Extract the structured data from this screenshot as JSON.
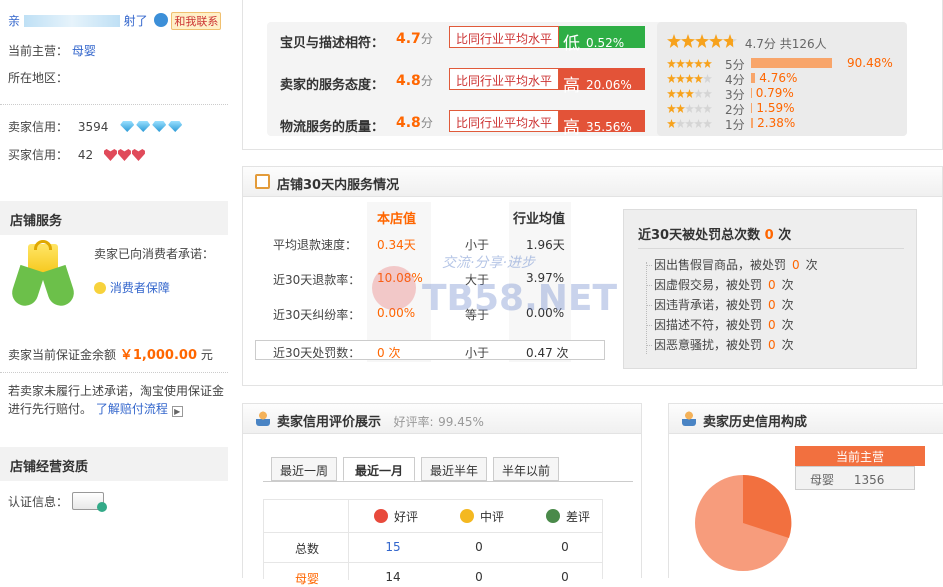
{
  "left": {
    "greet_prefix": "亲",
    "greet_suffix": "射了",
    "contact_label": "和我联系",
    "owner_label": "当前主营：",
    "owner_value": "母婴",
    "region_label": "所在地区：",
    "seller_credit_label": "卖家信用：",
    "seller_credit_value": "3594",
    "buyer_credit_label": "买家信用：",
    "buyer_credit_value": "42",
    "service_heading": "店铺服务",
    "promise_text": "卖家已向消费者承诺：",
    "protection_link": "消费者保障",
    "deposit_label": "卖家当前保证金余额",
    "deposit_value": "￥1,000.00",
    "deposit_unit": "元",
    "note_text": "若卖家未履行上述承诺，淘宝使用保证金进行先行赔付。",
    "claim_link": "了解赔付流程",
    "qual_heading": "店铺经营资质",
    "cert_label": "认证信息："
  },
  "ratings": {
    "rows": [
      {
        "label": "宝贝与描述相符：",
        "score": "4.7",
        "unit": "分",
        "cmp_label": "比同行业平均水平",
        "dir": "低",
        "pct": "0.52%",
        "color": "#2eae45"
      },
      {
        "label": "卖家的服务态度：",
        "score": "4.8",
        "unit": "分",
        "cmp_label": "比同行业平均水平",
        "dir": "高",
        "pct": "20.06%",
        "color": "#e35338"
      },
      {
        "label": "物流服务的质量：",
        "score": "4.8",
        "unit": "分",
        "cmp_label": "比同行业平均水平",
        "dir": "高",
        "pct": "35.56%",
        "color": "#e35338"
      }
    ],
    "summary_score": "4.7分",
    "summary_count": "共126人",
    "summary_stars": 4.7,
    "dist": [
      {
        "label": "5分",
        "pct": "90.48%",
        "value": 90.48,
        "stars": 5
      },
      {
        "label": "4分",
        "pct": "4.76%",
        "value": 4.76,
        "stars": 4
      },
      {
        "label": "3分",
        "pct": "0.79%",
        "value": 0.79,
        "stars": 3
      },
      {
        "label": "2分",
        "pct": "1.59%",
        "value": 1.59,
        "stars": 2
      },
      {
        "label": "1分",
        "pct": "2.38%",
        "value": 2.38,
        "stars": 1
      }
    ]
  },
  "service": {
    "title": "店铺30天内服务情况",
    "col_store": "本店值",
    "col_industry": "行业均值",
    "rows": [
      {
        "label": "平均退款速度：",
        "store": "0.34天",
        "cmp": "小于",
        "industry": "1.96天"
      },
      {
        "label": "近30天退款率：",
        "store": "10.08%",
        "cmp": "大于",
        "industry": "3.97%"
      },
      {
        "label": "近30天纠纷率：",
        "store": "0.00%",
        "cmp": "等于",
        "industry": "0.00%"
      },
      {
        "label": "近30天处罚数：",
        "store": "0 次",
        "cmp": "小于",
        "industry": "0.47 次"
      }
    ],
    "penalty_title_pre": "近30天被处罚总次数",
    "penalty_total": "0",
    "penalty_title_post": "次",
    "penalties": [
      {
        "pre": "因出售假冒商品，被处罚",
        "n": "0",
        "post": "次"
      },
      {
        "pre": "因虚假交易，被处罚",
        "n": "0",
        "post": "次"
      },
      {
        "pre": "因违背承诺，被处罚",
        "n": "0",
        "post": "次"
      },
      {
        "pre": "因描述不符，被处罚",
        "n": "0",
        "post": "次"
      },
      {
        "pre": "因恶意骚扰，被处罚",
        "n": "0",
        "post": "次"
      }
    ]
  },
  "credit_eval": {
    "title": "卖家信用评价展示",
    "rate_label": "好评率:",
    "rate_value": "99.45%",
    "tabs": [
      "最近一周",
      "最近一月",
      "最近半年",
      "半年以前"
    ],
    "active_tab": 1,
    "cols": [
      "好评",
      "中评",
      "差评"
    ],
    "rows": [
      {
        "label": "总数",
        "values": [
          "15",
          "0",
          "0"
        ]
      },
      {
        "label": "母婴",
        "values": [
          "14",
          "0",
          "0"
        ]
      }
    ]
  },
  "history": {
    "title": "卖家历史信用构成",
    "current_label": "当前主营",
    "category": "母婴",
    "value": "1356"
  },
  "watermark": "TB58.NET",
  "watermark_sub": "交流·分享·进步"
}
